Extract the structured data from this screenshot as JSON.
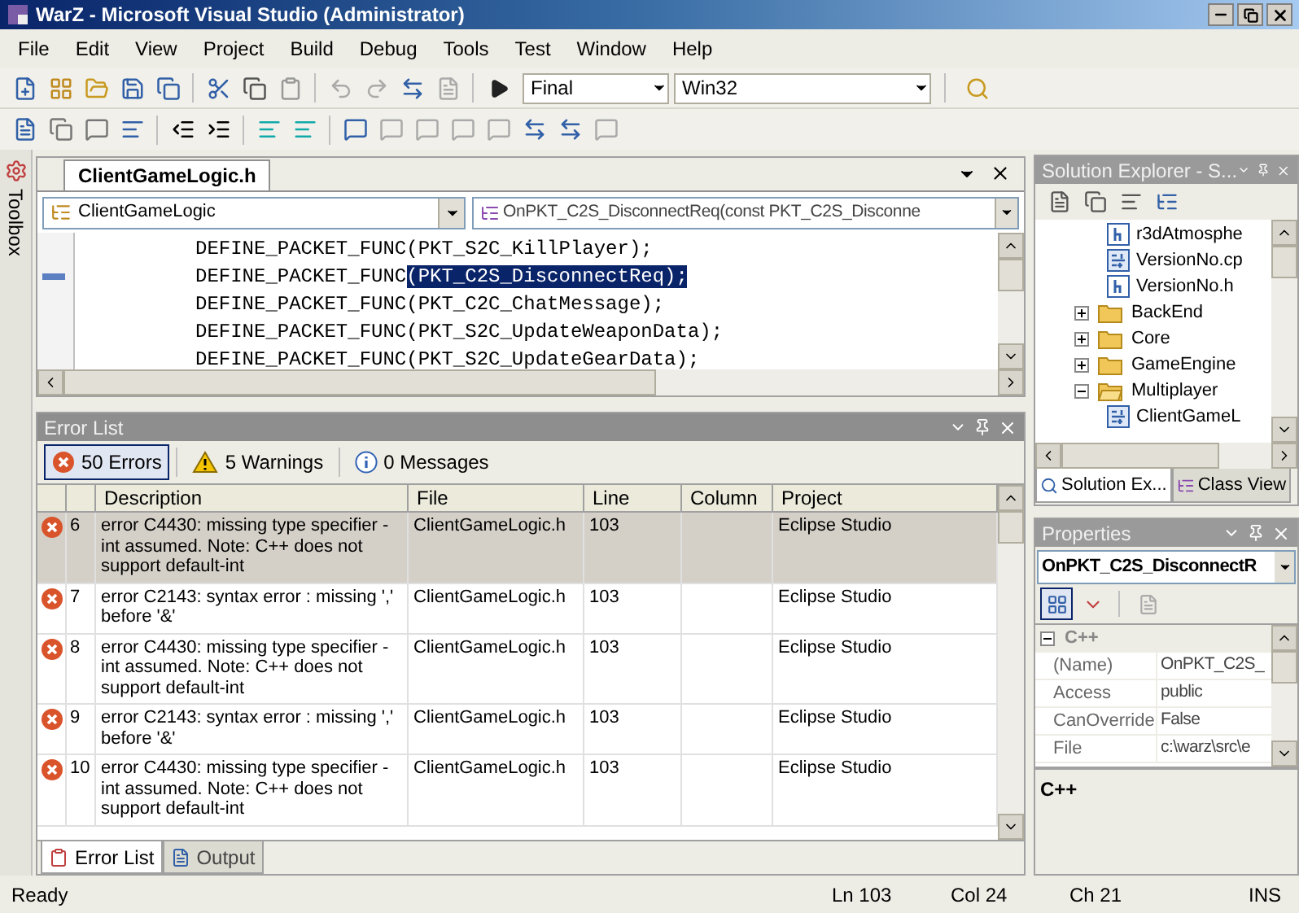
{
  "window": {
    "title": "WarZ - Microsoft Visual Studio (Administrator)"
  },
  "menu": [
    "File",
    "Edit",
    "View",
    "Project",
    "Build",
    "Debug",
    "Tools",
    "Test",
    "Window",
    "Help"
  ],
  "toolbar": {
    "configuration": "Final",
    "platform": "Win32"
  },
  "toolbox": {
    "label": "Toolbox"
  },
  "editor": {
    "tab": "ClientGameLogic.h",
    "class_dropdown": "ClientGameLogic",
    "member_dropdown": "OnPKT_C2S_DisconnectReq(const PKT_C2S_Disconne",
    "lines": [
      {
        "text": "DEFINE_PACKET_FUNC(PKT_S2C_KillPlayer);",
        "bookmark": false
      },
      {
        "text": "DEFINE_PACKET_FUNC",
        "selected_text": "(PKT_C2S_DisconnectReq);",
        "bookmark": true
      },
      {
        "text": "DEFINE_PACKET_FUNC(PKT_C2C_ChatMessage);",
        "bookmark": false
      },
      {
        "text": "DEFINE_PACKET_FUNC(PKT_S2C_UpdateWeaponData);",
        "bookmark": false
      },
      {
        "text": "DEFINE_PACKET_FUNC(PKT_S2C_UpdateGearData);",
        "bookmark": false
      }
    ]
  },
  "error_list": {
    "title": "Error List",
    "filters": [
      {
        "kind": "error",
        "label": "50 Errors",
        "selected": true
      },
      {
        "kind": "warning",
        "label": "5 Warnings",
        "selected": false
      },
      {
        "kind": "message",
        "label": "0 Messages",
        "selected": false
      }
    ],
    "columns": [
      "Description",
      "File",
      "Line",
      "Column",
      "Project"
    ],
    "rows": [
      {
        "number": "6",
        "description": "error C4430: missing type specifier - int assumed. Note: C++ does not support default-int",
        "file": "ClientGameLogic.h",
        "line": "103",
        "project": "Eclipse Studio",
        "selected": true
      },
      {
        "number": "7",
        "description": "error C2143: syntax error : missing ',' before '&'",
        "file": "ClientGameLogic.h",
        "line": "103",
        "project": "Eclipse Studio",
        "selected": false
      },
      {
        "number": "8",
        "description": "error C4430: missing type specifier - int assumed. Note: C++ does not support default-int",
        "file": "ClientGameLogic.h",
        "line": "103",
        "project": "Eclipse Studio",
        "selected": false
      },
      {
        "number": "9",
        "description": "error C2143: syntax error : missing ',' before '&'",
        "file": "ClientGameLogic.h",
        "line": "103",
        "project": "Eclipse Studio",
        "selected": false
      },
      {
        "number": "10",
        "description": "error C4430: missing type specifier - int assumed. Note: C++ does not support default-int",
        "file": "ClientGameLogic.h",
        "line": "103",
        "project": "Eclipse Studio",
        "selected": false
      }
    ],
    "tabs": [
      {
        "label": "Error List",
        "selected": true
      },
      {
        "label": "Output",
        "selected": false
      }
    ]
  },
  "solution_explorer": {
    "title": "Solution Explorer - S...",
    "continued_children": [
      {
        "label": "r3dAtmosphe",
        "kind": "header"
      },
      {
        "label": "VersionNo.cp",
        "kind": "cpp"
      },
      {
        "label": "VersionNo.h",
        "kind": "header"
      }
    ],
    "items": [
      {
        "label": "BackEnd",
        "expanded": false
      },
      {
        "label": "Core",
        "expanded": false
      },
      {
        "label": "GameEngine",
        "expanded": false
      },
      {
        "label": "Multiplayer",
        "expanded": true,
        "children": [
          {
            "label": "ClientGameL",
            "kind": "cpp"
          }
        ]
      }
    ],
    "tabs": [
      {
        "label": "Solution Ex...",
        "selected": true
      },
      {
        "label": "Class View",
        "selected": false
      }
    ]
  },
  "properties": {
    "title": "Properties",
    "object": "OnPKT_C2S_DisconnectR",
    "view_buttons": [
      {
        "kind": "categorized",
        "selected": true
      },
      {
        "kind": "alphabetical",
        "selected": false
      }
    ],
    "category": {
      "label": "C++",
      "expanded": true
    },
    "rows": [
      {
        "name": "(Name)",
        "value": "OnPKT_C2S_"
      },
      {
        "name": "Access",
        "value": "public"
      },
      {
        "name": "CanOverride",
        "value": "False"
      },
      {
        "name": "File",
        "value": "c:\\warz\\src\\e"
      }
    ],
    "description": "C++"
  },
  "status_bar": {
    "state": "Ready",
    "line": "Ln 103",
    "column": "Col 24",
    "char": "Ch 21",
    "mode": "INS"
  }
}
